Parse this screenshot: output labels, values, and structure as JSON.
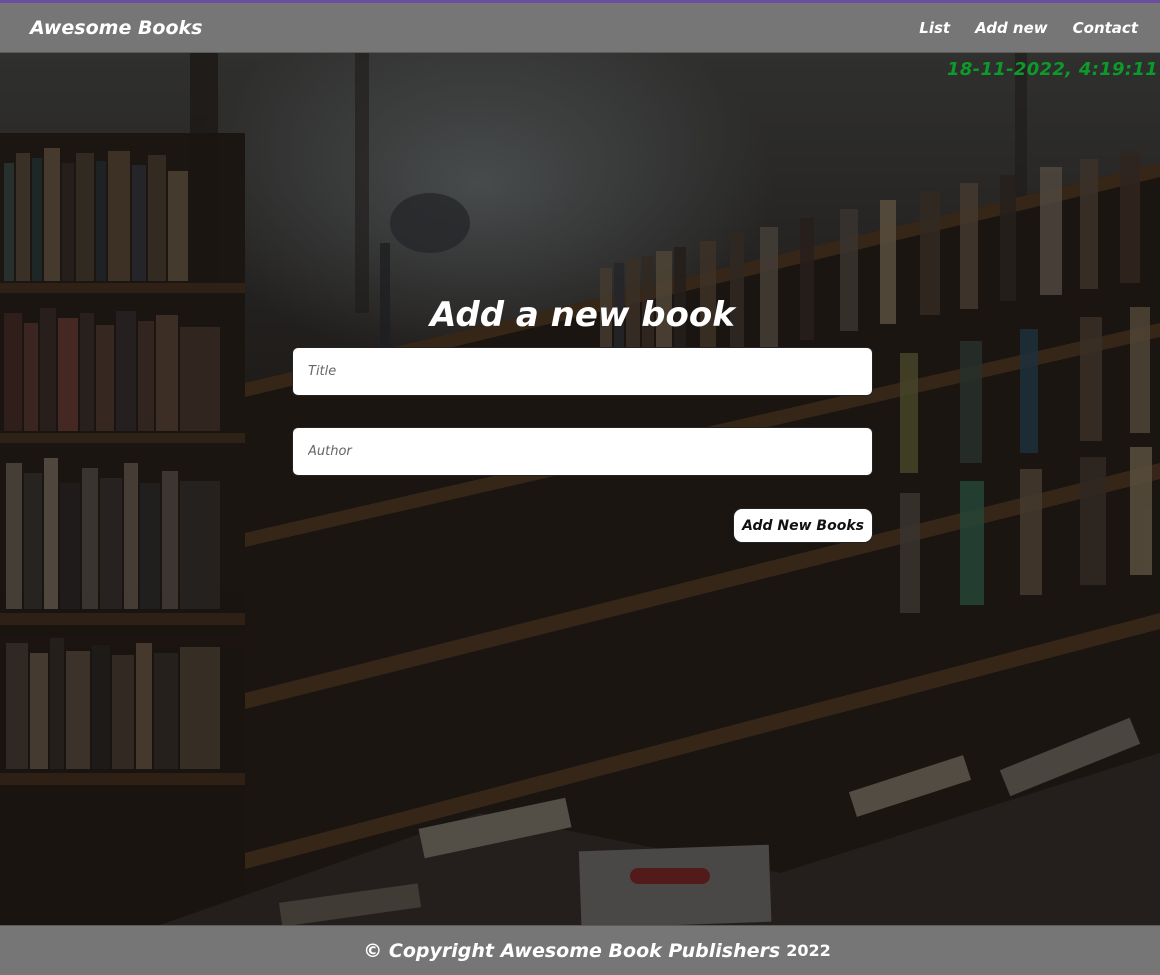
{
  "navbar": {
    "brand": "Awesome Books",
    "links": [
      {
        "label": "List"
      },
      {
        "label": "Add new"
      },
      {
        "label": "Contact"
      }
    ]
  },
  "datetime": "18-11-2022, 4:19:11",
  "form": {
    "heading": "Add a new book",
    "title_placeholder": "Title",
    "author_placeholder": "Author",
    "submit_label": "Add New Books"
  },
  "footer": {
    "text": "© Copyright Awesome Book Publishers",
    "year": "2022"
  },
  "colors": {
    "navbar_bg": "#767676",
    "accent_bar": "#6b4ea0",
    "datetime": "#0c9a2a",
    "text": "#ffffff"
  }
}
